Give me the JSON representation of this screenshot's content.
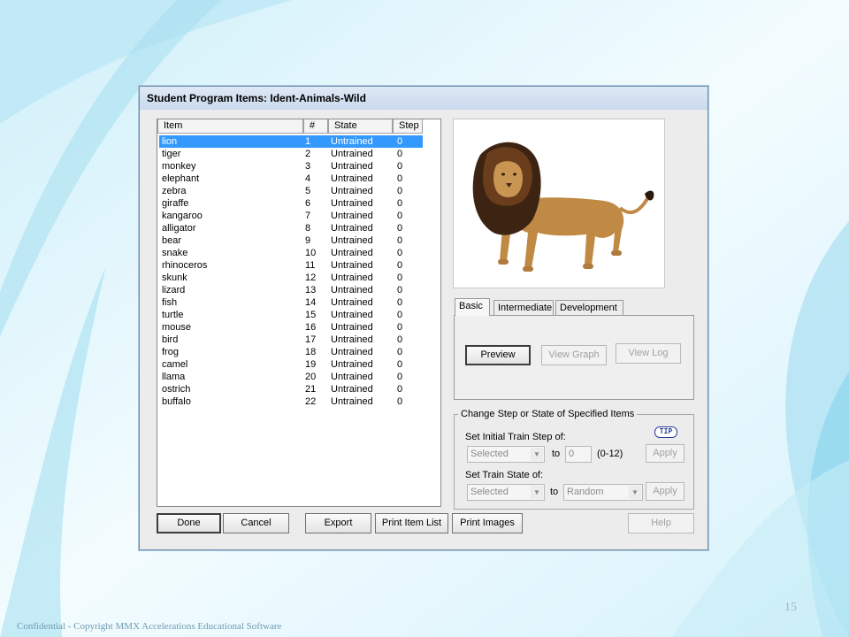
{
  "window": {
    "title": "Student Program Items: Ident-Animals-Wild"
  },
  "list": {
    "columns": [
      "Item",
      "#",
      "State",
      "Step"
    ],
    "rows": [
      {
        "item": "lion",
        "num": "1",
        "state": "Untrained",
        "step": "0"
      },
      {
        "item": "tiger",
        "num": "2",
        "state": "Untrained",
        "step": "0"
      },
      {
        "item": "monkey",
        "num": "3",
        "state": "Untrained",
        "step": "0"
      },
      {
        "item": "elephant",
        "num": "4",
        "state": "Untrained",
        "step": "0"
      },
      {
        "item": "zebra",
        "num": "5",
        "state": "Untrained",
        "step": "0"
      },
      {
        "item": "giraffe",
        "num": "6",
        "state": "Untrained",
        "step": "0"
      },
      {
        "item": "kangaroo",
        "num": "7",
        "state": "Untrained",
        "step": "0"
      },
      {
        "item": "alligator",
        "num": "8",
        "state": "Untrained",
        "step": "0"
      },
      {
        "item": "bear",
        "num": "9",
        "state": "Untrained",
        "step": "0"
      },
      {
        "item": "snake",
        "num": "10",
        "state": "Untrained",
        "step": "0"
      },
      {
        "item": "rhinoceros",
        "num": "11",
        "state": "Untrained",
        "step": "0"
      },
      {
        "item": "skunk",
        "num": "12",
        "state": "Untrained",
        "step": "0"
      },
      {
        "item": "lizard",
        "num": "13",
        "state": "Untrained",
        "step": "0"
      },
      {
        "item": "fish",
        "num": "14",
        "state": "Untrained",
        "step": "0"
      },
      {
        "item": "turtle",
        "num": "15",
        "state": "Untrained",
        "step": "0"
      },
      {
        "item": "mouse",
        "num": "16",
        "state": "Untrained",
        "step": "0"
      },
      {
        "item": "bird",
        "num": "17",
        "state": "Untrained",
        "step": "0"
      },
      {
        "item": "frog",
        "num": "18",
        "state": "Untrained",
        "step": "0"
      },
      {
        "item": "camel",
        "num": "19",
        "state": "Untrained",
        "step": "0"
      },
      {
        "item": "llama",
        "num": "20",
        "state": "Untrained",
        "step": "0"
      },
      {
        "item": "ostrich",
        "num": "21",
        "state": "Untrained",
        "step": "0"
      },
      {
        "item": "buffalo",
        "num": "22",
        "state": "Untrained",
        "step": "0"
      }
    ]
  },
  "tabs": [
    "Basic",
    "Intermediate",
    "Development"
  ],
  "basic_panel": {
    "preview": "Preview",
    "view_graph": "View Graph",
    "view_log": "View Log"
  },
  "change_group": {
    "title": "Change Step or State of Specified Items",
    "tip": "TIP",
    "step_label": "Set Initial Train Step of:",
    "step_scope": "Selected",
    "to1": "to",
    "step_value": "0",
    "step_range": "(0-12)",
    "apply1": "Apply",
    "state_label": "Set Train State of:",
    "state_scope": "Selected",
    "to2": "to",
    "state_value": "Random",
    "apply2": "Apply"
  },
  "bottom_buttons": {
    "done": "Done",
    "cancel": "Cancel",
    "export": "Export",
    "print_item_list": "Print Item List",
    "print_images": "Print Images",
    "help": "Help"
  },
  "slide": {
    "footer": "Confidential - Copyright MMX Accelerations Educational Software",
    "page_number": "15"
  }
}
